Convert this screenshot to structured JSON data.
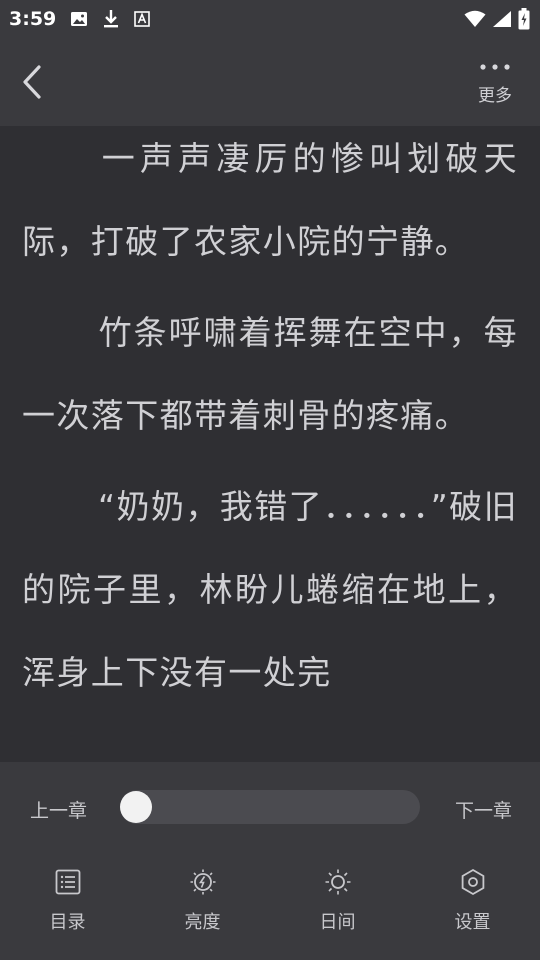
{
  "status_bar": {
    "time": "3:59",
    "icons": [
      "image-icon",
      "download-icon",
      "a-font-icon",
      "wifi-icon",
      "signal-icon",
      "battery-icon"
    ]
  },
  "top_bar": {
    "more_label": "更多"
  },
  "content": {
    "paragraphs": [
      "一声声凄厉的惨叫划破天际，打破了农家小院的宁静。",
      "竹条呼啸着挥舞在空中，每一次落下都带着刺骨的疼痛。",
      "“奶奶，我错了．．．．．．”破旧的院子里，林盼儿蜷缩在地上，浑身上下没有一处完"
    ]
  },
  "bottom": {
    "prev_chapter": "上一章",
    "next_chapter": "下一章",
    "progress": 0.0,
    "nav": [
      {
        "label": "目录",
        "icon": "list-icon"
      },
      {
        "label": "亮度",
        "icon": "brightness-icon"
      },
      {
        "label": "日间",
        "icon": "sun-icon"
      },
      {
        "label": "设置",
        "icon": "settings-icon"
      }
    ]
  },
  "colors": {
    "background": "#2f2f33",
    "panel": "#3a3a3e",
    "text": "#d0d0d4"
  }
}
